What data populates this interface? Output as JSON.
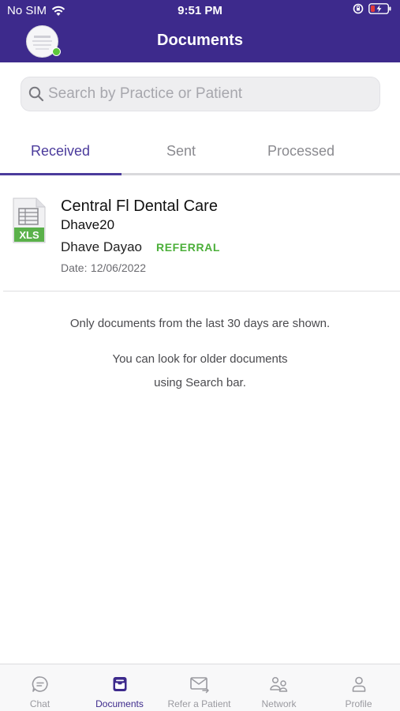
{
  "status_bar": {
    "carrier": "No SIM",
    "time": "9:51 PM"
  },
  "header": {
    "title": "Documents"
  },
  "search": {
    "placeholder": "Search by Practice or Patient"
  },
  "tabs": [
    {
      "label": "Received",
      "active": true
    },
    {
      "label": "Sent",
      "active": false
    },
    {
      "label": "Processed",
      "active": false
    }
  ],
  "documents": [
    {
      "file_type": "XLS",
      "practice": "Central Fl Dental Care",
      "user": "Dhave20",
      "patient": "Dhave Dayao",
      "tag": "REFERRAL",
      "date_label": "Date:",
      "date_value": "12/06/2022"
    }
  ],
  "info": {
    "line1": "Only documents from the last 30 days are shown.",
    "line2": "You can look for older documents",
    "line3": "using Search bar."
  },
  "bottom_nav": [
    {
      "label": "Chat",
      "icon": "chat-icon",
      "active": false
    },
    {
      "label": "Documents",
      "icon": "documents-icon",
      "active": true
    },
    {
      "label": "Refer a Patient",
      "icon": "refer-icon",
      "active": false
    },
    {
      "label": "Network",
      "icon": "network-icon",
      "active": false
    },
    {
      "label": "Profile",
      "icon": "profile-icon",
      "active": false
    }
  ],
  "colors": {
    "header_bg": "#3d2a8c",
    "accent": "#4b3b9c",
    "tag_green": "#4caf3a",
    "online_dot": "#5cc63a"
  }
}
